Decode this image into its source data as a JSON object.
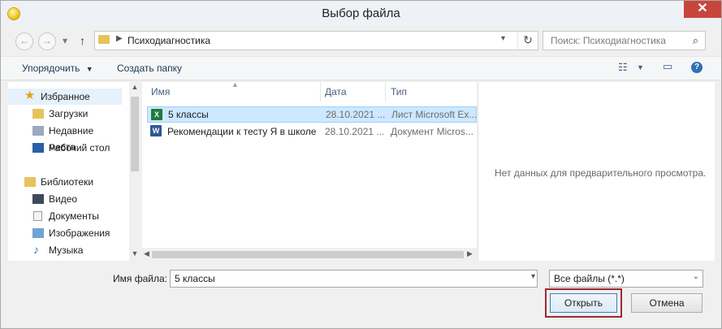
{
  "window": {
    "title": "Выбор файла",
    "close_glyph": "✕"
  },
  "address": {
    "path": "Психодиагностика",
    "search_placeholder": "Поиск: Психодиагностика"
  },
  "toolbar": {
    "organize_label": "Упорядочить",
    "new_folder_label": "Создать папку",
    "help_glyph": "?"
  },
  "nav": {
    "items": [
      {
        "label": "Избранное",
        "icon": "star-icon",
        "selected": true
      },
      {
        "label": "Загрузки",
        "icon": "downloads-icon"
      },
      {
        "label": "Недавние места",
        "icon": "recent-places-icon"
      },
      {
        "label": "Рабочий стол",
        "icon": "desktop-icon"
      },
      {
        "label": "Библиотеки",
        "icon": "libraries-icon"
      },
      {
        "label": "Видео",
        "icon": "video-icon"
      },
      {
        "label": "Документы",
        "icon": "documents-icon"
      },
      {
        "label": "Изображения",
        "icon": "pictures-icon"
      },
      {
        "label": "Музыка",
        "icon": "music-icon"
      }
    ]
  },
  "files": {
    "columns": {
      "name": "Имя",
      "date": "Дата измене...",
      "type": "Тип"
    },
    "rows": [
      {
        "name": "5 классы",
        "date": "28.10.2021 ...",
        "type": "Лист Microsoft Ex...",
        "icon": "excel-icon",
        "selected": true
      },
      {
        "name": "Рекомендации к тесту Я в школе",
        "date": "28.10.2021 ...",
        "type": "Документ Micros...",
        "icon": "word-icon"
      }
    ]
  },
  "preview": {
    "message": "Нет данных для предварительного просмотра."
  },
  "bottom": {
    "filename_label": "Имя файла:",
    "filename_value": "5 классы",
    "filter_value": "Все файлы (*.*)",
    "open_label": "Открыть",
    "cancel_label": "Отмена"
  },
  "colors": {
    "accent": "#3c7fb1",
    "highlight_box": "#9b2a33",
    "close_button": "#c7463b"
  }
}
